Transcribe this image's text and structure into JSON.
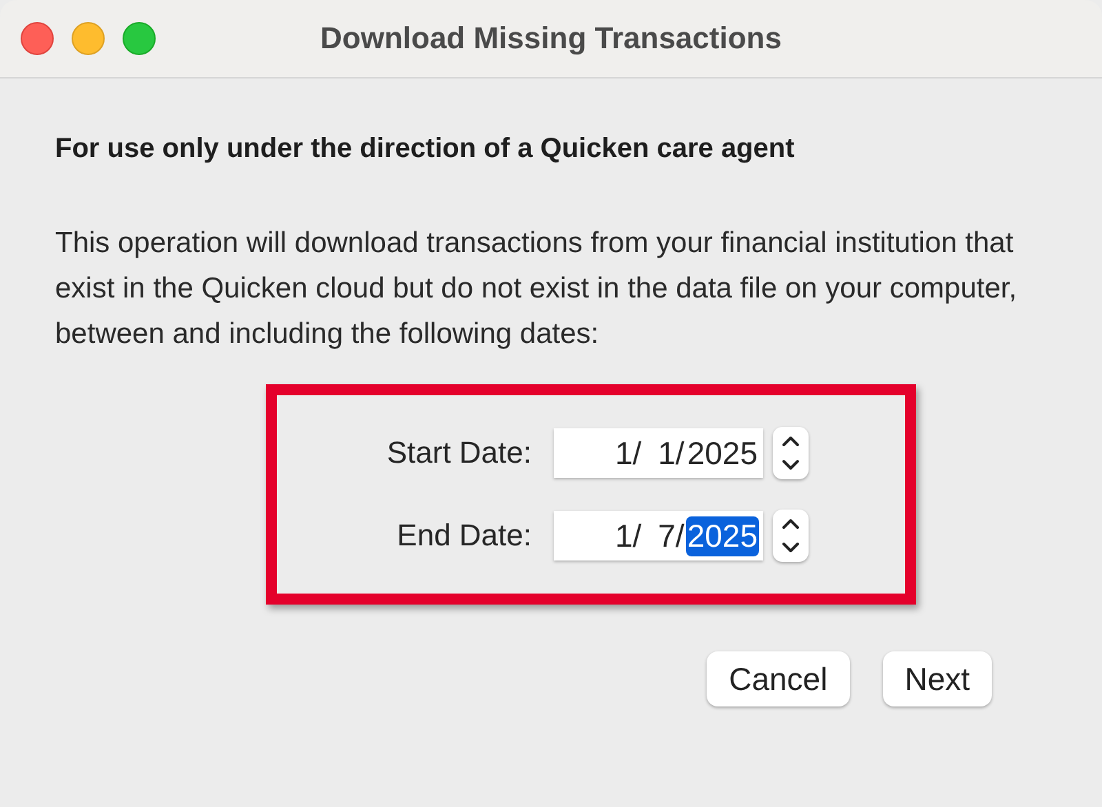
{
  "window": {
    "title": "Download Missing Transactions"
  },
  "heading": "For use only under the direction of a Quicken care agent",
  "description": "This operation will download transactions from your financial institution that exist in the Quicken cloud but do not exist in the data file on your computer, between and including the following dates:",
  "date_fields": [
    {
      "label": "Start Date:",
      "segments": [
        {
          "text": "1/",
          "selected": false
        },
        {
          "text": "1/",
          "selected": false
        },
        {
          "text": "2025",
          "selected": false
        }
      ]
    },
    {
      "label": "End Date:",
      "segments": [
        {
          "text": "1/",
          "selected": false
        },
        {
          "text": "7/",
          "selected": false
        },
        {
          "text": "2025",
          "selected": true
        }
      ]
    }
  ],
  "buttons": [
    "Cancel",
    "Next"
  ]
}
